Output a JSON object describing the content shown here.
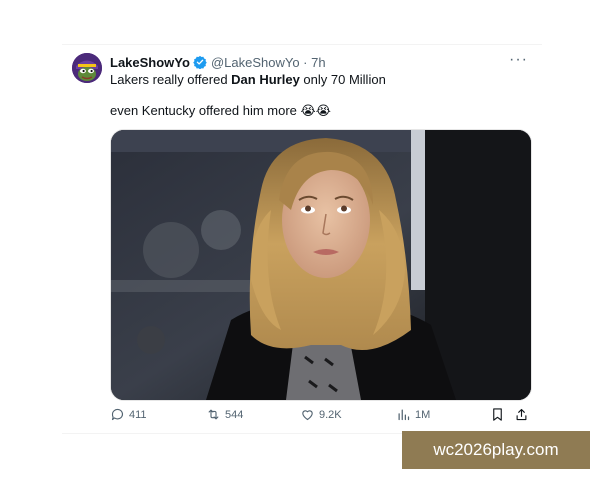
{
  "tweet": {
    "display_name": "LakeShowYo",
    "handle_time": "@LakeShowYo · 7h",
    "line1_before": "Lakers really offered ",
    "line1_bold": "Dan Hurley",
    "line1_after": " only 70 Million",
    "line2_text": "even Kentucky offered him more ",
    "line2_emoji": "😭😭",
    "more_label": "···"
  },
  "actions": {
    "replies": "411",
    "reposts": "544",
    "likes": "9.2K",
    "views": "1M"
  },
  "icons": {
    "verified": "verified-badge-icon",
    "reply": "reply-icon",
    "repost": "repost-icon",
    "like": "heart-icon",
    "views": "views-icon",
    "bookmark": "bookmark-icon",
    "share": "share-icon"
  },
  "colors": {
    "verified_blue": "#1d9bf0",
    "muted_text": "#536471",
    "watermark_bg": "#8f7b53"
  },
  "watermark": {
    "text": "wc2026play.com"
  }
}
